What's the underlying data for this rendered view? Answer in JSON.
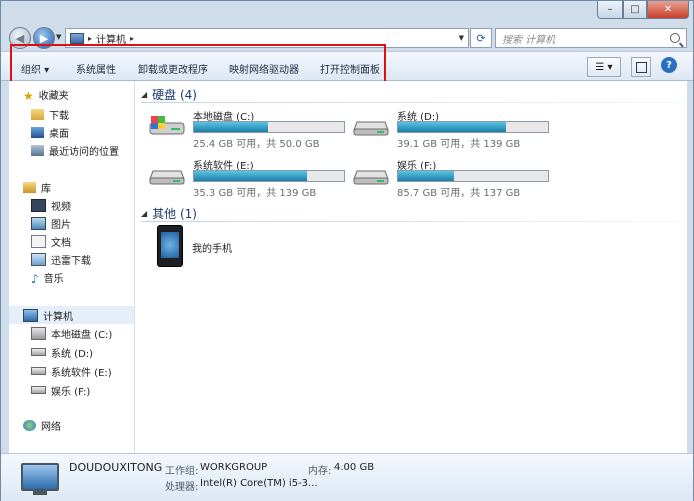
{
  "window": {
    "minimize_glyph": "–",
    "maximize_glyph": "□",
    "close_glyph": "✕"
  },
  "address": {
    "separator": "▸",
    "crumb": "计算机",
    "search_placeholder": "搜索 计算机"
  },
  "toolbar": {
    "organize": "组织 ▾",
    "system_properties": "系统属性",
    "uninstall": "卸载或更改程序",
    "map_drive": "映射网络驱动器",
    "control_panel": "打开控制面板",
    "help": "?",
    "highlight_color": "#dd1111"
  },
  "sidebar": {
    "favorites": {
      "title": "收藏夹",
      "items": [
        "下载",
        "桌面",
        "最近访问的位置"
      ]
    },
    "libraries": {
      "title": "库",
      "items": [
        "视频",
        "图片",
        "文档",
        "迅雷下载",
        "音乐"
      ]
    },
    "computer": {
      "title": "计算机",
      "items": [
        "本地磁盘 (C:)",
        "系统 (D:)",
        "系统软件 (E:)",
        "娱乐 (F:)"
      ]
    },
    "network": {
      "title": "网络"
    }
  },
  "content": {
    "drives_group": "硬盘 (4)",
    "other_group": "其他 (1)",
    "drives": [
      {
        "name": "本地磁盘 (C:)",
        "free": "25.4 GB 可用，共 50.0 GB",
        "used_fraction": 0.49
      },
      {
        "name": "系统 (D:)",
        "free": "39.1 GB 可用，共 139 GB",
        "used_fraction": 0.72
      },
      {
        "name": "系统软件 (E:)",
        "free": "35.3 GB 可用，共 139 GB",
        "used_fraction": 0.75
      },
      {
        "name": "娱乐 (F:)",
        "free": "85.7 GB 可用，共 137 GB",
        "used_fraction": 0.37
      }
    ],
    "phone": "我的手机"
  },
  "details": {
    "computer_name": "DOUDOUXITONG",
    "workgroup_label": "工作组:",
    "workgroup_value": "WORKGROUP",
    "memory_label": "内存:",
    "memory_value": "4.00 GB",
    "cpu_label": "处理器:",
    "cpu_value": "Intel(R) Core(TM) i5-3..."
  }
}
